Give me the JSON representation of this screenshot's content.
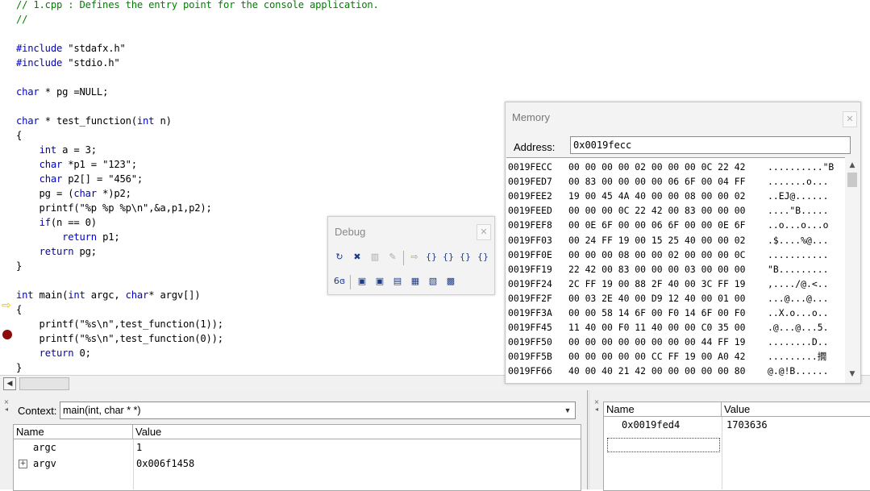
{
  "editor": {
    "lines": [
      [
        {
          "t": "// 1.cpp : Defines the entry point for the console application.",
          "c": "cm"
        }
      ],
      [
        {
          "t": "//",
          "c": "cm"
        }
      ],
      [],
      [
        {
          "t": "#include",
          "c": "kw"
        },
        {
          "t": " \"stdafx.h\""
        }
      ],
      [
        {
          "t": "#include",
          "c": "kw"
        },
        {
          "t": " \"stdio.h\""
        }
      ],
      [],
      [
        {
          "t": "char",
          "c": "kw"
        },
        {
          "t": " * pg =NULL;"
        }
      ],
      [],
      [
        {
          "t": "char",
          "c": "kw"
        },
        {
          "t": " * test_function("
        },
        {
          "t": "int",
          "c": "kw"
        },
        {
          "t": " n)"
        }
      ],
      [
        {
          "t": "{"
        }
      ],
      [
        {
          "t": "    "
        },
        {
          "t": "int",
          "c": "kw"
        },
        {
          "t": " a = 3;"
        }
      ],
      [
        {
          "t": "    "
        },
        {
          "t": "char",
          "c": "kw"
        },
        {
          "t": " *p1 = \"123\";"
        }
      ],
      [
        {
          "t": "    "
        },
        {
          "t": "char",
          "c": "kw"
        },
        {
          "t": " p2[] = \"456\";"
        }
      ],
      [
        {
          "t": "    pg = ("
        },
        {
          "t": "char",
          "c": "kw"
        },
        {
          "t": " *)p2;"
        }
      ],
      [
        {
          "t": "    printf(\"%p %p %p\\n\",&a,p1,p2);"
        }
      ],
      [
        {
          "t": "    "
        },
        {
          "t": "if",
          "c": "kw"
        },
        {
          "t": "(n == 0)"
        }
      ],
      [
        {
          "t": "        "
        },
        {
          "t": "return",
          "c": "kw"
        },
        {
          "t": " p1;"
        }
      ],
      [
        {
          "t": "    "
        },
        {
          "t": "return",
          "c": "kw"
        },
        {
          "t": " pg;"
        }
      ],
      [
        {
          "t": "}"
        }
      ],
      [],
      [
        {
          "t": "int",
          "c": "kw"
        },
        {
          "t": " main("
        },
        {
          "t": "int",
          "c": "kw"
        },
        {
          "t": " argc, "
        },
        {
          "t": "char",
          "c": "kw"
        },
        {
          "t": "* argv[])"
        }
      ],
      [
        {
          "t": "{"
        }
      ],
      [
        {
          "t": "    printf(\"%s\\n\",test_function(1));"
        }
      ],
      [
        {
          "t": "    printf(\"%s\\n\",test_function(0));"
        }
      ],
      [
        {
          "t": "    "
        },
        {
          "t": "return",
          "c": "kw"
        },
        {
          "t": " 0;"
        }
      ],
      [
        {
          "t": "}"
        }
      ]
    ],
    "exec_arrow_icon": "current-statement-arrow-icon",
    "breakpoint_icon": "breakpoint-icon"
  },
  "memory": {
    "title": "Memory",
    "address_label": "Address:",
    "address_value": "0x0019fecc",
    "rows": [
      {
        "addr": "0019FECC",
        "hex": "00 00 00 00 02 00 00 00 0C 22 42",
        "ascii": "..........\"B"
      },
      {
        "addr": "0019FED7",
        "hex": "00 83 00 00 00 00 06 6F 00 04 FF",
        "ascii": ".......o..."
      },
      {
        "addr": "0019FEE2",
        "hex": "19 00 45 4A 40 00 00 08 00 00 02",
        "ascii": "..EJ@......"
      },
      {
        "addr": "0019FEED",
        "hex": "00 00 00 0C 22 42 00 83 00 00 00",
        "ascii": "....\"B....."
      },
      {
        "addr": "0019FEF8",
        "hex": "00 0E 6F 00 00 06 6F 00 00 0E 6F",
        "ascii": "..o...o...o"
      },
      {
        "addr": "0019FF03",
        "hex": "00 24 FF 19 00 15 25 40 00 00 02",
        "ascii": ".$....%@..."
      },
      {
        "addr": "0019FF0E",
        "hex": "00 00 00 08 00 00 02 00 00 00 0C",
        "ascii": "..........."
      },
      {
        "addr": "0019FF19",
        "hex": "22 42 00 83 00 00 00 03 00 00 00",
        "ascii": "\"B........."
      },
      {
        "addr": "0019FF24",
        "hex": "2C FF 19 00 88 2F 40 00 3C FF 19",
        "ascii": ",..../@.<.."
      },
      {
        "addr": "0019FF2F",
        "hex": "00 03 2E 40 00 D9 12 40 00 01 00",
        "ascii": "...@...@..."
      },
      {
        "addr": "0019FF3A",
        "hex": "00 00 58 14 6F 00 F0 14 6F 00 F0",
        "ascii": "..X.o...o.."
      },
      {
        "addr": "0019FF45",
        "hex": "11 40 00 F0 11 40 00 00 C0 35 00",
        "ascii": ".@...@...5."
      },
      {
        "addr": "0019FF50",
        "hex": "00 00 00 00 00 00 00 00 44 FF 19",
        "ascii": "........D.."
      },
      {
        "addr": "0019FF5B",
        "hex": "00 00 00 00 00 CC FF 19 00 A0 42",
        "ascii": ".........撊"
      },
      {
        "addr": "0019FF66",
        "hex": "40 00 40 21 42 00 00 00 00 00 80",
        "ascii": "@.@!B......"
      }
    ]
  },
  "debug": {
    "title": "Debug",
    "row1": [
      "restart-icon",
      "stop-debugging-icon",
      "break-execution-icon",
      "apply-code-changes-icon",
      "show-next-statement-icon",
      "step-into-icon",
      "step-over-icon",
      "step-out-icon",
      "run-to-cursor-icon"
    ],
    "row2": [
      "quickwatch-icon",
      "watch-window-icon",
      "variables-window-icon",
      "registers-window-icon",
      "memory-window-icon",
      "call-stack-icon",
      "disassembly-icon"
    ]
  },
  "variables": {
    "context_label": "Context:",
    "context_value": "main(int, char * *)",
    "headers": {
      "name": "Name",
      "value": "Value"
    },
    "rows": [
      {
        "name": "argc",
        "value": "1",
        "expandable": false
      },
      {
        "name": "argv",
        "value": "0x006f1458",
        "expandable": true
      }
    ]
  },
  "watch": {
    "headers": {
      "name": "Name",
      "value": "Value"
    },
    "rows": [
      {
        "name": "0x0019fed4",
        "value": "1703636"
      }
    ]
  },
  "colors": {
    "keyword": "#0000d0",
    "comment": "#008000",
    "breakpoint": "#8b0a0a",
    "exec_arrow": "#e0c000"
  }
}
